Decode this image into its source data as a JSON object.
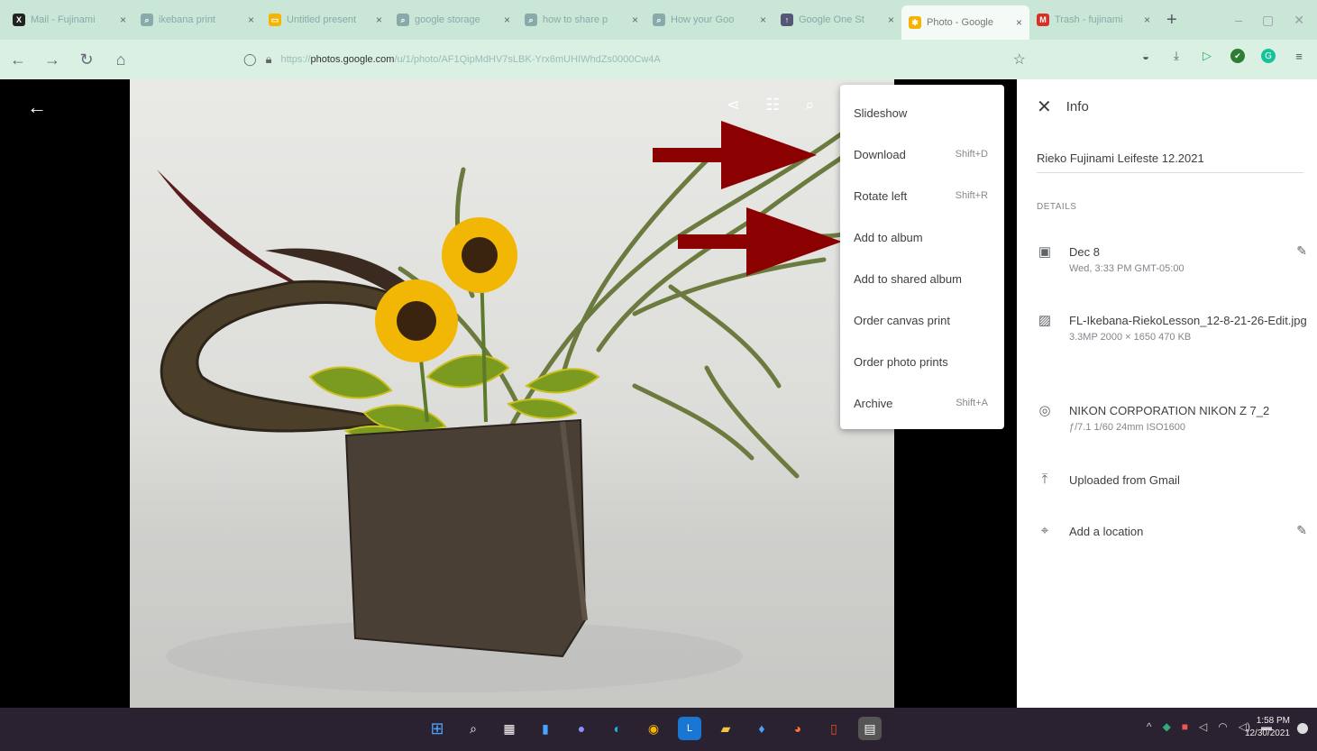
{
  "browser": {
    "tabs": [
      {
        "icon": "x-brand-icon",
        "fav_color": "#222",
        "fav_glyph": "X",
        "title": "Mail - Fujinami"
      },
      {
        "icon": "search-icon",
        "fav_color": "#8aa",
        "fav_glyph": "⌕",
        "title": "ikebana print"
      },
      {
        "icon": "slides-icon",
        "fav_color": "#f4b400",
        "fav_glyph": "▭",
        "title": "Untitled present"
      },
      {
        "icon": "search-icon",
        "fav_color": "#8aa",
        "fav_glyph": "⌕",
        "title": "google storage"
      },
      {
        "icon": "search-icon",
        "fav_color": "#8aa",
        "fav_glyph": "⌕",
        "title": "how to share p"
      },
      {
        "icon": "search-icon",
        "fav_color": "#8aa",
        "fav_glyph": "⌕",
        "title": "How your Goo"
      },
      {
        "icon": "upload-icon",
        "fav_color": "#557",
        "fav_glyph": "↑",
        "title": "Google One St"
      },
      {
        "icon": "photos-icon",
        "fav_color": "#f4b400",
        "fav_glyph": "✱",
        "title": "Photo - Google"
      },
      {
        "icon": "gmail-icon",
        "fav_color": "#d93025",
        "fav_glyph": "M",
        "title": "Trash - fujinami"
      }
    ],
    "url_pre": "https://",
    "url_domain": "photos.google.com",
    "url_rest": "/u/1/photo/AF1QipMdHV7sLBK-Yrx6mUHIWhdZs0000Cw4A"
  },
  "viewer": {
    "menu": [
      {
        "label": "Slideshow",
        "shortcut": ""
      },
      {
        "label": "Download",
        "shortcut": "Shift+D"
      },
      {
        "label": "Rotate left",
        "shortcut": "Shift+R"
      },
      {
        "label": "Add to album",
        "shortcut": ""
      },
      {
        "label": "Add to shared album",
        "shortcut": ""
      },
      {
        "label": "Order canvas print",
        "shortcut": ""
      },
      {
        "label": "Order photo prints",
        "shortcut": ""
      },
      {
        "label": "Archive",
        "shortcut": "Shift+A"
      }
    ]
  },
  "info": {
    "title": "Info",
    "description": "Rieko Fujinami Leifeste 12.2021",
    "details_label": "DETAILS",
    "date": "Dec 8",
    "date_sub": "Wed, 3:33 PM   GMT-05:00",
    "file_name": "FL-Ikebana-RiekoLesson_12-8-21-26-Edit.jpg",
    "file_sub": "3.3MP   2000 × 1650   470 KB",
    "camera": "NIKON CORPORATION NIKON Z 7_2",
    "camera_sub": "ƒ/7.1   1/60   24mm   ISO1600",
    "uploaded": "Uploaded from Gmail",
    "location": "Add a location"
  },
  "taskbar": {
    "time": "1:58 PM",
    "date": "12/30/2021"
  },
  "colors": {
    "arrow": "#8b0000",
    "link": "#1a73e8"
  }
}
